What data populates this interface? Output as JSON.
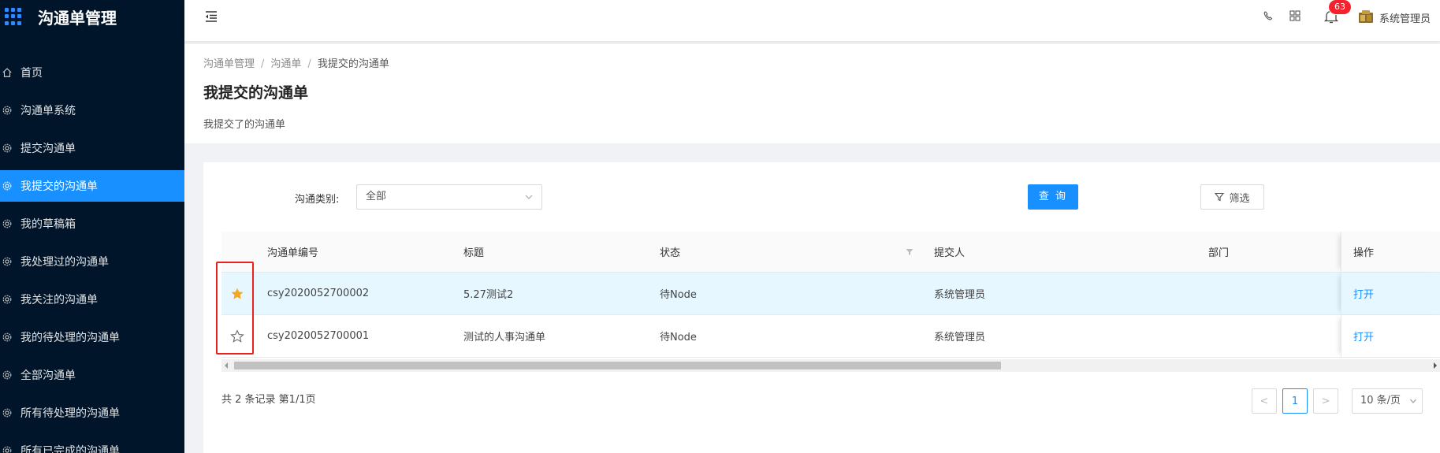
{
  "app": {
    "title": "沟通单管理"
  },
  "sidebar": {
    "items": [
      {
        "label": "首页",
        "icon": "home-icon",
        "active": false
      },
      {
        "label": "沟通单系统",
        "icon": "gear-icon",
        "active": false
      },
      {
        "label": "提交沟通单",
        "icon": "gear-icon",
        "active": false
      },
      {
        "label": "我提交的沟通单",
        "icon": "gear-icon",
        "active": true
      },
      {
        "label": "我的草稿箱",
        "icon": "gear-icon",
        "active": false
      },
      {
        "label": "我处理过的沟通单",
        "icon": "gear-icon",
        "active": false
      },
      {
        "label": "我关注的沟通单",
        "icon": "gear-icon",
        "active": false
      },
      {
        "label": "我的待处理的沟通单",
        "icon": "gear-icon",
        "active": false
      },
      {
        "label": "全部沟通单",
        "icon": "gear-icon",
        "active": false
      },
      {
        "label": "所有待处理的沟通单",
        "icon": "gear-icon",
        "active": false
      },
      {
        "label": "所有已完成的沟通单",
        "icon": "gear-icon",
        "active": false
      }
    ]
  },
  "header": {
    "notification_count": "63",
    "username": "系统管理员",
    "icons": [
      "menu-fold-icon",
      "phone-icon",
      "apps-icon",
      "bell-icon",
      "avatar-icon"
    ]
  },
  "page": {
    "breadcrumb": [
      "沟通单管理",
      "沟通单",
      "我提交的沟通单"
    ],
    "title": "我提交的沟通单",
    "description": "我提交了的沟通单"
  },
  "filter": {
    "category_label": "沟通类别:",
    "category_value": "全部",
    "query_button": "查 询",
    "filter_button": "筛选"
  },
  "table": {
    "columns": {
      "id": "沟通单编号",
      "title": "标题",
      "status": "状态",
      "submitter": "提交人",
      "dept": "部门",
      "op": "操作"
    },
    "rows": [
      {
        "starred": true,
        "id": "csy2020052700002",
        "title": "5.27测试2",
        "status": "待Node",
        "submitter": "系统管理员",
        "dept": "",
        "op": "打开"
      },
      {
        "starred": false,
        "id": "csy2020052700001",
        "title": "测试的人事沟通单",
        "status": "待Node",
        "submitter": "系统管理员",
        "dept": "",
        "op": "打开"
      }
    ]
  },
  "pagination": {
    "summary": "共 2 条记录 第1/1页",
    "current_page": "1",
    "page_size": "10 条/页",
    "prev": "<",
    "next": ">"
  },
  "colors": {
    "accent": "#1890ff",
    "sidebar_bg": "#001529",
    "star": "#f5a623",
    "highlight_box": "#e8231d"
  }
}
